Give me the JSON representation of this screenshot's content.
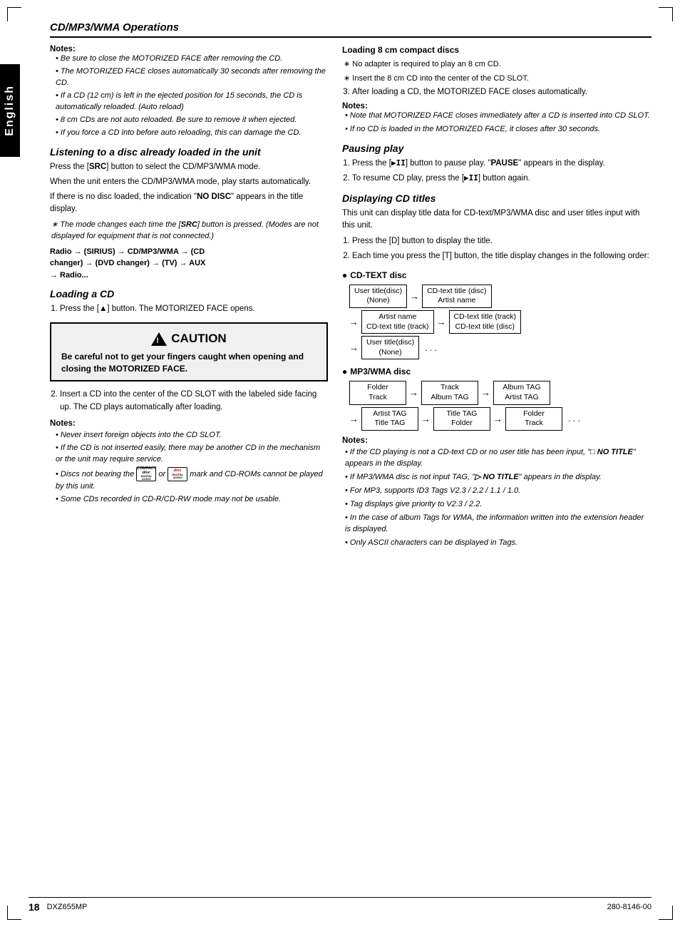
{
  "page": {
    "title": "CD/MP3/WMA Operations",
    "side_tab": "English",
    "page_number": "18",
    "model": "DXZ655MP",
    "doc_number": "280-8146-00"
  },
  "left_col": {
    "notes_label": "Notes:",
    "notes": [
      "Be sure to close the MOTORIZED FACE after removing the CD.",
      "The MOTORIZED FACE closes automatically 30 seconds after removing the CD.",
      "If a CD (12 cm) is left in the ejected position for 15 seconds, the CD is automatically reloaded. (Auto reload)",
      "8 cm CDs are not auto reloaded.  Be sure to remove it when ejected.",
      "If you force a CD into before auto reloading, this can damage the CD."
    ],
    "listening_title": "Listening to a disc already loaded in the unit",
    "listening_body1": "Press the [SRC] button to select the CD/MP3/WMA mode.",
    "listening_body2": "When the unit enters the CD/MP3/WMA mode, play starts automatically.",
    "listening_body3": "If there is no disc loaded, the indication \"NO DISC\" appears in the title display.",
    "listening_note": "The mode changes each time the [SRC] button is pressed. (Modes are not displayed for equipment that is not connected.)",
    "flow_label": "Radio → (SIRIUS) → CD/MP3/WMA → (CD changer) → (DVD changer) → (TV) → AUX → Radio...",
    "loading_title": "Loading a CD",
    "loading_step1": "Press the [▲] button. The MOTORIZED FACE opens.",
    "caution_title": "CAUTION",
    "caution_body": "Be careful not to get your fingers caught when opening and closing the MOTORIZED FACE.",
    "loading_step2": "Insert a CD into the center of the CD SLOT with the labeled side facing up. The CD plays automatically after loading.",
    "loading_notes_label": "Notes:",
    "loading_notes": [
      "Never insert foreign objects into the CD SLOT.",
      "If the CD is not inserted easily, there may be another CD in the mechanism or the unit may require service.",
      "Discs not bearing the  or  mark and CD-ROMs cannot  be played by this unit.",
      "Some CDs recorded in CD-R/CD-RW mode may not be usable."
    ]
  },
  "right_col": {
    "loading_8cm_title": "Loading 8 cm compact discs",
    "loading_8cm_note1": "No adapter is required to play an 8 cm CD.",
    "loading_8cm_note2": "Insert the 8 cm CD into the center of the CD SLOT.",
    "loading_8cm_step3": "After loading a CD, the MOTORIZED FACE closes automatically.",
    "notes_label": "Notes:",
    "loading_8cm_notes": [
      "Note that MOTORIZED FACE closes immediately after a CD is inserted into CD SLOT.",
      "If no CD is loaded in the MOTORIZED FACE, it closes after 30 seconds."
    ],
    "pausing_title": "Pausing play",
    "pausing_step1_pre": "Press the [",
    "pausing_step1_btn": "▶II",
    "pausing_step1_post": "] button to pause play. \"PAUSE\" appears in the display.",
    "pausing_step2_pre": "To resume CD play, press the [",
    "pausing_step2_btn": "▶II",
    "pausing_step2_post": "] button again.",
    "displaying_title": "Displaying CD titles",
    "displaying_body": "This unit can display title data for CD-text/MP3/WMA disc and user titles input with this unit.",
    "displaying_step1": "Press the [D] button to display the title.",
    "displaying_step2": "Each time you press the [T] button, the title display changes in the following order:",
    "cdtext_disc_label": "CD-TEXT disc",
    "cdtext_flow": [
      [
        "User title(disc)\n(None)",
        "→",
        "CD-text title (disc)\nArtist name"
      ],
      [
        "→",
        "Artist name\nCD-text title (track)",
        "→",
        "CD-text title (track)\nCD-text title (disc)"
      ],
      [
        "→",
        "User title(disc)\n(None)",
        "..."
      ]
    ],
    "mp3_disc_label": "MP3/WMA disc",
    "mp3_flow": [
      [
        "Folder\nTrack",
        "→",
        "Track\nAlbum TAG",
        "→",
        "Album TAG\nArtist TAG"
      ],
      [
        "→",
        "Artist TAG\nTitle TAG",
        "→",
        "Title TAG\nFolder",
        "→",
        "Folder\nTrack",
        "..."
      ]
    ],
    "bottom_notes_label": "Notes:",
    "bottom_notes": [
      "If the CD playing is not a CD-text CD or no user title has been input, \" NO TITLE\" appears in the display.",
      "If MP3/WMA disc is not input TAG, \" NO TITLE\" appears in the display.",
      "For MP3, supports ID3 Tags V2.3 / 2.2 / 1.1 / 1.0.",
      "Tag displays give priority to V2.3 / 2.2.",
      "In the case of album Tags for WMA, the information written into the extension header is displayed.",
      "Only ASCII characters can be displayed in Tags."
    ]
  }
}
